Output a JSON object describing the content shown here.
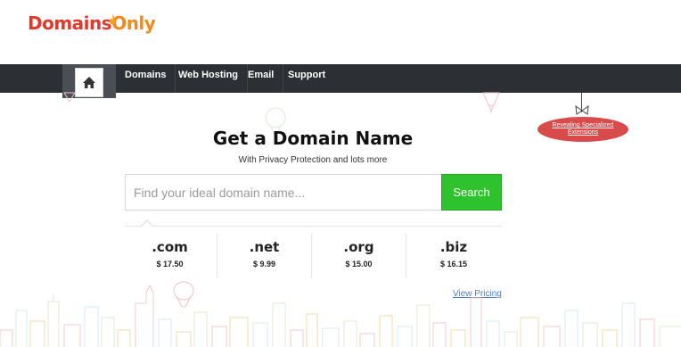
{
  "brand": {
    "name_part1": "Domains",
    "name_part2": "Only"
  },
  "nav": {
    "home_icon": "home-icon",
    "items": [
      {
        "label": "Domains"
      },
      {
        "label": "Web Hosting"
      },
      {
        "label": "Email"
      },
      {
        "label": "Support"
      }
    ]
  },
  "promo_tag": {
    "line1": "Revealing Specialized",
    "line2": "Extensions"
  },
  "main": {
    "title": "Get a Domain Name",
    "subtitle": "With Privacy Protection and lots more"
  },
  "search": {
    "placeholder": "Find your ideal domain name...",
    "value": "",
    "button_label": "Search"
  },
  "tlds": [
    {
      "ext": ".com",
      "price": "$ 17.50"
    },
    {
      "ext": ".net",
      "price": "$ 9.99"
    },
    {
      "ext": ".org",
      "price": "$ 15.00"
    },
    {
      "ext": ".biz",
      "price": "$ 16.15"
    }
  ],
  "links": {
    "view_pricing": "View Pricing"
  },
  "colors": {
    "brand_red": "#e23a2a",
    "brand_orange": "#f08a1c",
    "nav_bg": "#2c2f33",
    "search_green": "#2ec22c",
    "tag_red": "#d94a4a",
    "link_blue": "#4a7fc4"
  }
}
